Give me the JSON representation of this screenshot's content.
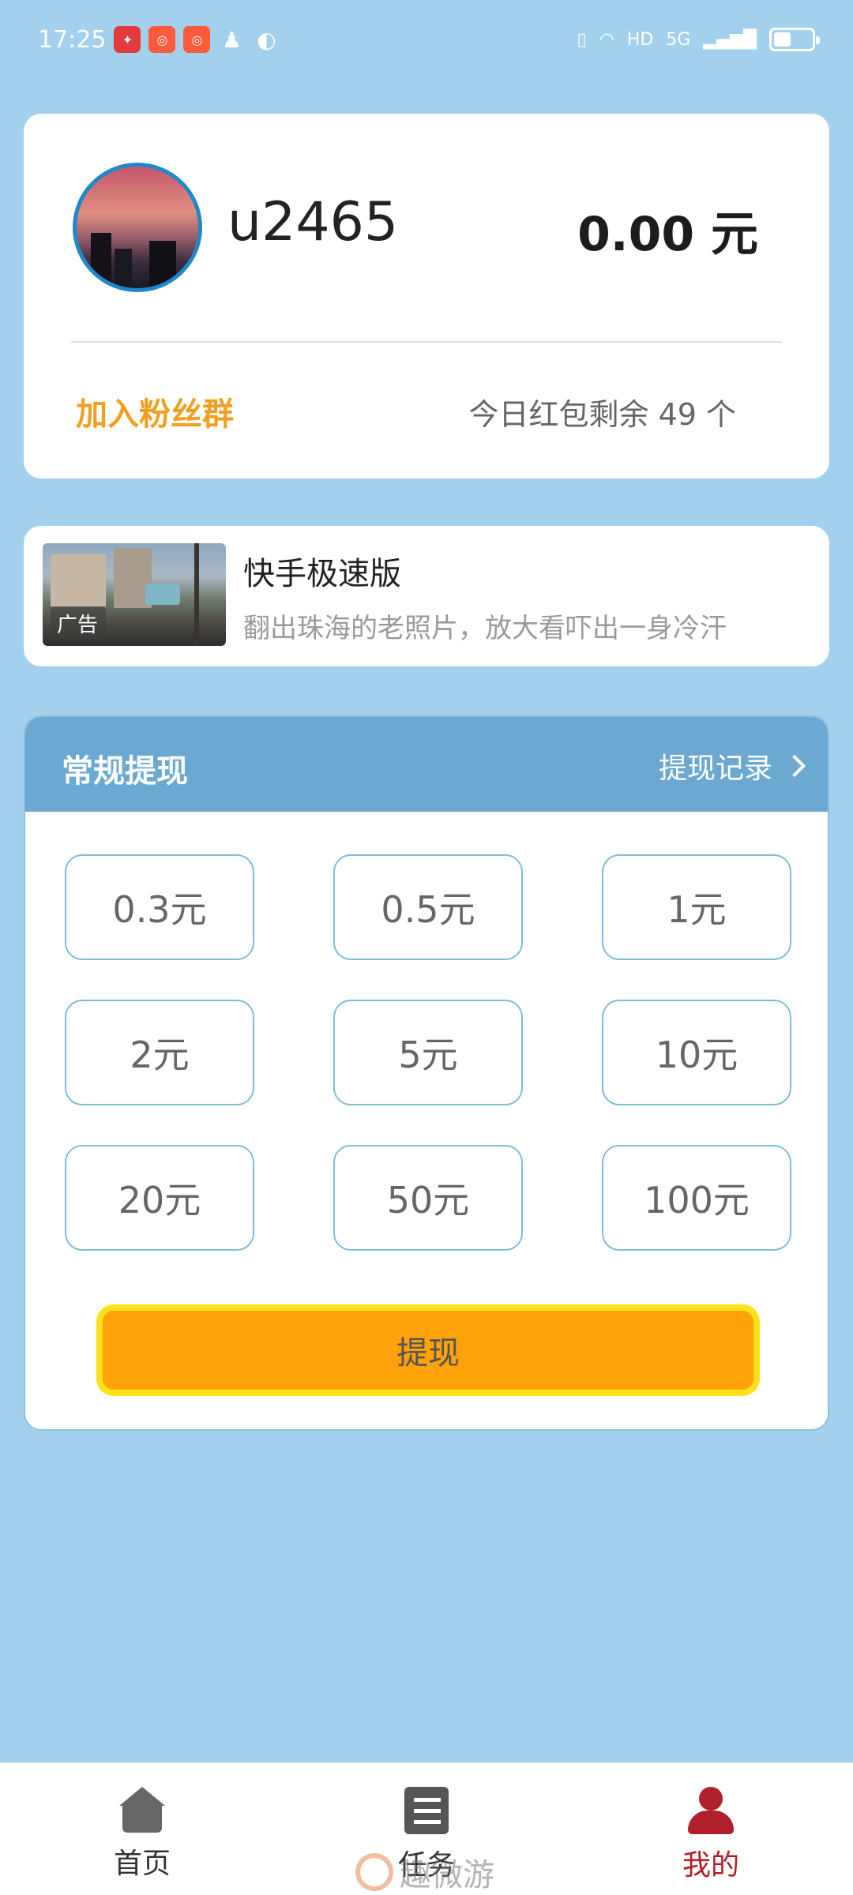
{
  "status_bar": {
    "time": "17:25",
    "network": "5G",
    "hd_label": "HD",
    "battery_percent": 45
  },
  "profile": {
    "username": "u2465",
    "balance": "0.00 元",
    "fan_group_link": "加入粉丝群",
    "red_packet_remaining": "今日红包剩余 49 个"
  },
  "ad": {
    "title": "快手极速版",
    "description": "翻出珠海的老照片，放大看吓出一身冷汗",
    "tag": "广告"
  },
  "withdraw": {
    "title": "常规提现",
    "record_link": "提现记录",
    "amounts": [
      "0.3元",
      "0.5元",
      "1元",
      "2元",
      "5元",
      "10元",
      "20元",
      "50元",
      "100元"
    ],
    "submit_label": "提现"
  },
  "tab_bar": {
    "home": "首页",
    "task": "任务",
    "mine": "我的",
    "active": "mine",
    "active_color": "#b0202a"
  },
  "watermark": "趣微游"
}
